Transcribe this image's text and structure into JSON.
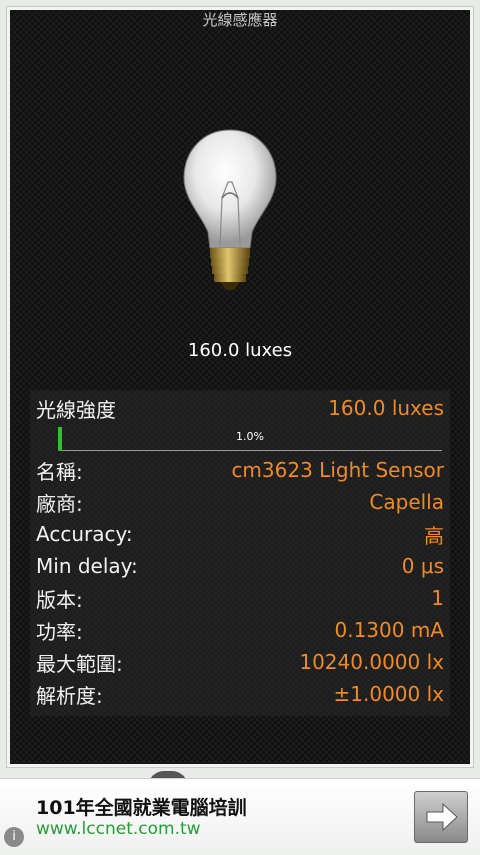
{
  "app": {
    "title": "光線感應器"
  },
  "main": {
    "lux_reading": "160.0 luxes"
  },
  "sensor": {
    "intensity_label": "光線強度",
    "intensity_value": "160.0 luxes",
    "progress_text": "1.0%",
    "progress_fraction": 0.01,
    "rows": [
      {
        "label": "名稱:",
        "value": "cm3623 Light Sensor"
      },
      {
        "label": "廠商:",
        "value": "Capella"
      },
      {
        "label": "Accuracy:",
        "value": "高"
      },
      {
        "label": "Min delay:",
        "value": "0 μs"
      },
      {
        "label": "版本:",
        "value": "1"
      },
      {
        "label": "功率:",
        "value": "0.1300 mA"
      },
      {
        "label": "最大範圍:",
        "value": "10240.0000 lx"
      },
      {
        "label": "解析度:",
        "value": "±1.0000 lx"
      }
    ]
  },
  "ad": {
    "title": "101年全國就業電腦培訓",
    "url": "www.lccnet.com.tw",
    "info_glyph": "i"
  },
  "colors": {
    "accent": "#f08a24",
    "progress": "#2fbf2f",
    "ad_link": "#2a9a3a"
  }
}
